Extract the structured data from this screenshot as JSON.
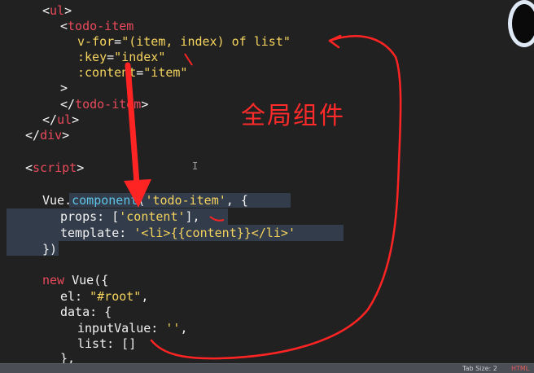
{
  "code": {
    "l1_open": "<",
    "l1_tag": "ul",
    "l1_close": ">",
    "l2_open": "<",
    "l2_tag": "todo-item",
    "l3_attr": "v-for",
    "l3_eq": "=",
    "l3_val": "\"(item, index) of list\"",
    "l4_attr": ":key",
    "l4_eq": "=",
    "l4_val": "\"index\"",
    "l5_attr": ":content",
    "l5_eq": "=",
    "l5_val": "\"item\"",
    "l6_close": ">",
    "l7_open": "</",
    "l7_tag": "todo-item",
    "l7_close": ">",
    "l8_open": "</",
    "l8_tag": "ul",
    "l8_close": ">",
    "l9_open": "</",
    "l9_tag": "div",
    "l9_close": ">",
    "l10_open": "<",
    "l10_tag": "script",
    "l10_close": ">",
    "l11_obj": "Vue.",
    "l11_fn": "component",
    "l11_p1": "(",
    "l11_str": "'todo-item'",
    "l11_p2": ", {",
    "l12_key": "props: ",
    "l12_p1": "[",
    "l12_str": "'content'",
    "l12_p2": "],",
    "l13_key": "template: ",
    "l13_str": "'<li>{{content}}</li>'",
    "l14_text": "})",
    "l15_kw": "new",
    "l15_rest": " Vue({",
    "l16_key": "el: ",
    "l16_str": "\"#root\"",
    "l16_p": ",",
    "l17_text": "data: {",
    "l18_key": "inputValue: ",
    "l18_str": "''",
    "l18_p": ",",
    "l19_text": "list: []",
    "l20_text": "},"
  },
  "annotation": {
    "label": "全局组件",
    "color": "#ff2a2a"
  },
  "status_bar": {
    "tab_size": "Tab Size: 2",
    "watermark": "HTML"
  },
  "colors": {
    "background": "#212121",
    "tag_name": "#e94a5b",
    "attribute": "#f4d35e",
    "string": "#f4d35e",
    "function": "#5ec4e6",
    "selection": "#333c4a"
  }
}
